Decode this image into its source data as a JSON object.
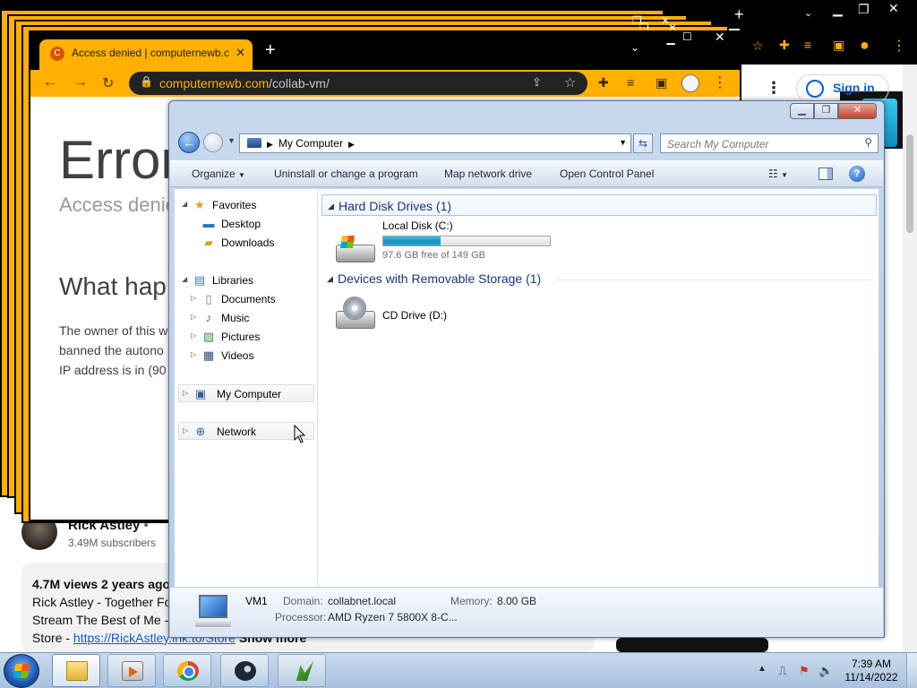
{
  "background_browser": {
    "tab_title": "Access denied | computernewb.c",
    "favicon_glyph": "C",
    "url_domain": "computernewb.com",
    "url_path": "/collab-vm/",
    "accent_color": "#ffb000",
    "page": {
      "error_title": "Error",
      "error_subtitle": "Access denie",
      "what_heading": "What hap",
      "body_line1": "The owner of this w",
      "body_line2": "banned the autono",
      "body_line3": "IP address is in (90"
    }
  },
  "youtube": {
    "sign_in": "Sign in",
    "channel_name": "Rick Astley",
    "channel_verified": "•",
    "subscribers": "3.49M subscribers",
    "views_meta": "4.7M views  2 years ago",
    "desc_line1": "Rick Astley - Together Fo",
    "desc_line2": "Stream The Best of Me -",
    "desc_line3_prefix": "Store - ",
    "desc_link": "https://RickAstley.lnk.to/Store",
    "show_more": "Show more"
  },
  "explorer": {
    "address": {
      "location": "My Computer",
      "search_placeholder": "Search My Computer"
    },
    "commands": {
      "organize": "Organize",
      "uninstall": "Uninstall or change a program",
      "map_drive": "Map network drive",
      "control_panel": "Open Control Panel"
    },
    "nav": {
      "favorites": "Favorites",
      "desktop": "Desktop",
      "downloads": "Downloads",
      "libraries": "Libraries",
      "documents": "Documents",
      "music": "Music",
      "pictures": "Pictures",
      "videos": "Videos",
      "my_computer": "My Computer",
      "network": "Network"
    },
    "groups": {
      "hard_disks": "Hard Disk Drives (1)",
      "removable": "Devices with Removable Storage (1)"
    },
    "drives": {
      "c_name": "Local Disk (C:)",
      "c_free_text": "97.6 GB free of 149 GB",
      "c_used_fraction": 0.345,
      "d_name": "CD Drive (D:)"
    },
    "details": {
      "computer_name": "VM1",
      "domain_label": "Domain:",
      "domain_value": "collabnet.local",
      "memory_label": "Memory:",
      "memory_value": "8.00 GB",
      "processor_label": "Processor:",
      "processor_value": "AMD Ryzen 7 5800X 8-C..."
    }
  },
  "taskbar": {
    "time": "7:39 AM",
    "date": "11/14/2022",
    "items": [
      "windows-explorer",
      "media-player",
      "chrome",
      "steam",
      "app"
    ]
  }
}
